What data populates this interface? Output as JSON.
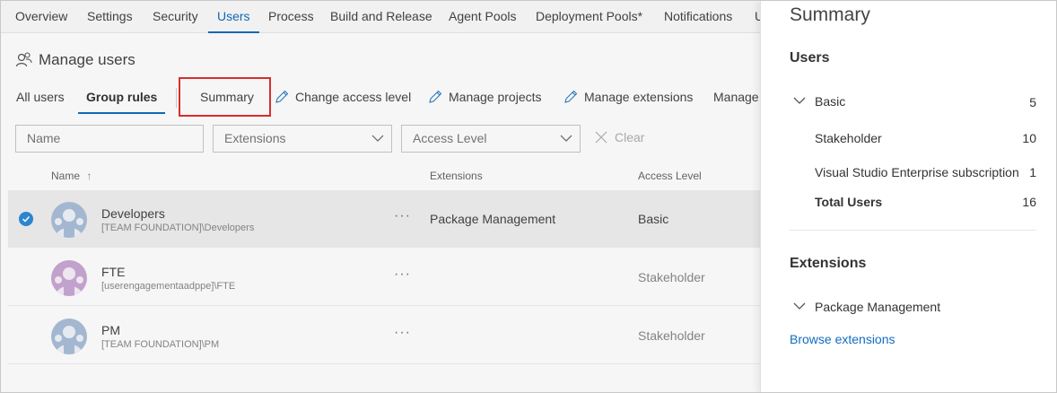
{
  "nav": {
    "tabs": [
      {
        "label": "Overview"
      },
      {
        "label": "Settings"
      },
      {
        "label": "Security"
      },
      {
        "label": "Users"
      },
      {
        "label": "Process"
      },
      {
        "label": "Build and Release"
      },
      {
        "label": "Agent Pools"
      },
      {
        "label": "Deployment Pools*"
      },
      {
        "label": "Notifications"
      },
      {
        "label": "U"
      }
    ],
    "active": "Users"
  },
  "header": {
    "title": "Manage users",
    "icon": "users-icon"
  },
  "subtabs": [
    {
      "label": "All users"
    },
    {
      "label": "Group rules"
    }
  ],
  "toolbar": {
    "summary": "Summary",
    "change_access": "Change access level",
    "manage_projects": "Manage projects",
    "manage_extensions": "Manage extensions",
    "manage_more": "Manage"
  },
  "filters": {
    "name_placeholder": "Name",
    "extensions": "Extensions",
    "access_level": "Access Level",
    "clear": "Clear"
  },
  "table": {
    "headers": {
      "name": "Name",
      "sort": "↑",
      "extensions": "Extensions",
      "access_level": "Access Level"
    },
    "rows": [
      {
        "name": "Developers",
        "sub": "[TEAM FOUNDATION]\\Developers",
        "more": "···",
        "extensions": "Package Management",
        "access": "Basic"
      },
      {
        "name": "FTE",
        "sub": "[userengagementaadppe]\\FTE",
        "more": "···",
        "extensions": "",
        "access": "Stakeholder"
      },
      {
        "name": "PM",
        "sub": "[TEAM FOUNDATION]\\PM",
        "more": "···",
        "extensions": "",
        "access": "Stakeholder"
      }
    ]
  },
  "summary": {
    "title": "Summary",
    "users_heading": "Users",
    "basic": {
      "label": "Basic",
      "count": "5"
    },
    "stakeholder": {
      "label": "Stakeholder",
      "count": "10"
    },
    "vs_enterprise": {
      "label": "Visual Studio Enterprise subscription",
      "count": "1"
    },
    "total": {
      "label": "Total Users",
      "count": "16"
    },
    "extensions_heading": "Extensions",
    "package_management": "Package Management",
    "browse": "Browse extensions"
  },
  "colors": {
    "accent": "#106ebe",
    "highlight": "#e02f2f",
    "check": "#2d8ad8",
    "avatar_blue": "#a9bed8",
    "avatar_purple": "#c9a8d4"
  }
}
